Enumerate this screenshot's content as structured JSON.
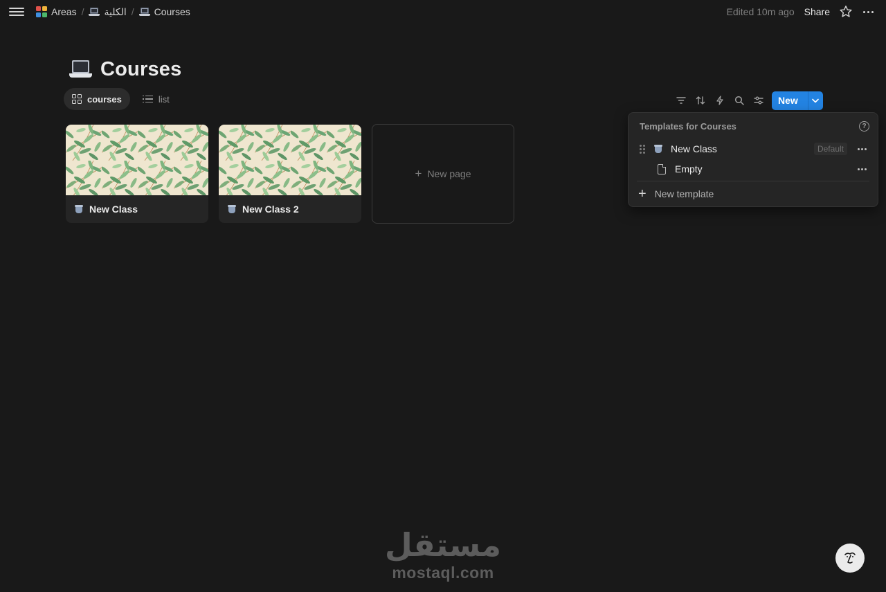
{
  "topbar": {
    "breadcrumbs": [
      {
        "label": "Areas",
        "icon": "apps-grid-icon"
      },
      {
        "label": "الكلية",
        "icon": "laptop-icon"
      },
      {
        "label": "Courses",
        "icon": "laptop-icon"
      }
    ],
    "separator": "/",
    "edited": "Edited 10m ago",
    "share": "Share"
  },
  "page": {
    "title": "Courses",
    "icon": "laptop-icon"
  },
  "views": [
    {
      "label": "courses",
      "icon": "gallery-icon",
      "active": true
    },
    {
      "label": "list",
      "icon": "list-icon",
      "active": false
    }
  ],
  "toolbar": {
    "tools": [
      "filter-icon",
      "sort-icon",
      "automation-bolt-icon",
      "search-icon",
      "settings-sliders-icon"
    ],
    "new_label": "New"
  },
  "cards": [
    {
      "title": "New Class",
      "icon": "bucket-icon",
      "cover": "leaf-pattern"
    },
    {
      "title": "New Class 2",
      "icon": "bucket-icon",
      "cover": "leaf-pattern"
    }
  ],
  "new_page": {
    "label": "New page"
  },
  "templates_popup": {
    "heading": "Templates for Courses",
    "items": [
      {
        "label": "New Class",
        "icon": "bucket-icon",
        "badge": "Default"
      },
      {
        "label": "Empty",
        "icon": "document-icon",
        "badge": ""
      }
    ],
    "new_template": "New template"
  },
  "watermark": {
    "arabic": "مستقل",
    "latin": "mostaql.com"
  },
  "colors": {
    "background": "#191919",
    "surface": "#252525",
    "accent": "#2383e2",
    "text": "#d4d4d4"
  }
}
